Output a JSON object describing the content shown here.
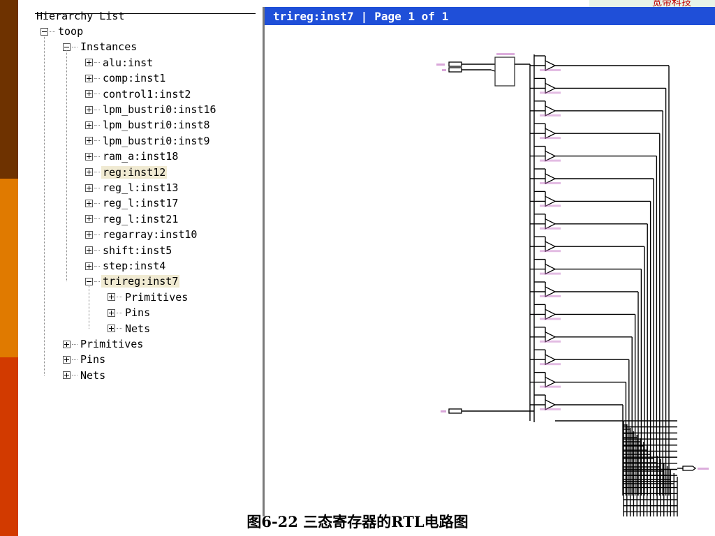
{
  "hierarchy": {
    "title": "Hierarchy List",
    "root": "toop",
    "instances_label": "Instances",
    "instances": [
      {
        "label": "alu:inst",
        "selected": false
      },
      {
        "label": "comp:inst1",
        "selected": false
      },
      {
        "label": "control1:inst2",
        "selected": false
      },
      {
        "label": "lpm_bustri0:inst16",
        "selected": false
      },
      {
        "label": "lpm_bustri0:inst8",
        "selected": false
      },
      {
        "label": "lpm_bustri0:inst9",
        "selected": false
      },
      {
        "label": "ram_a:inst18",
        "selected": false
      },
      {
        "label": "reg:inst12",
        "selected": true
      },
      {
        "label": "reg_l:inst13",
        "selected": false
      },
      {
        "label": "reg_l:inst17",
        "selected": false
      },
      {
        "label": "reg_l:inst21",
        "selected": false
      },
      {
        "label": "regarray:inst10",
        "selected": false
      },
      {
        "label": "shift:inst5",
        "selected": false
      },
      {
        "label": "step:inst4",
        "selected": false
      },
      {
        "label": "trireg:inst7",
        "selected": true
      }
    ],
    "trireg_children": [
      "Primitives",
      "Pins",
      "Nets"
    ],
    "root_children": [
      "Primitives",
      "Pins",
      "Nets"
    ],
    "icons": {
      "expanded": "minus-box-icon",
      "collapsed": "plus-box-icon"
    }
  },
  "schematic": {
    "title": "trireg:inst7",
    "page_label": "Page 1 of 1",
    "title_bar_color": "#1f4fd8",
    "wire_color": "#000000",
    "pin_label_color": "#c06ac0"
  },
  "caption": "图6-22  三态寄存器的RTL电路图",
  "corner_stamp": "宽带科技",
  "colors": {
    "bar_top": "#6e3200",
    "bar_mid": "#e07a00",
    "bar_bottom": "#d23a00"
  }
}
